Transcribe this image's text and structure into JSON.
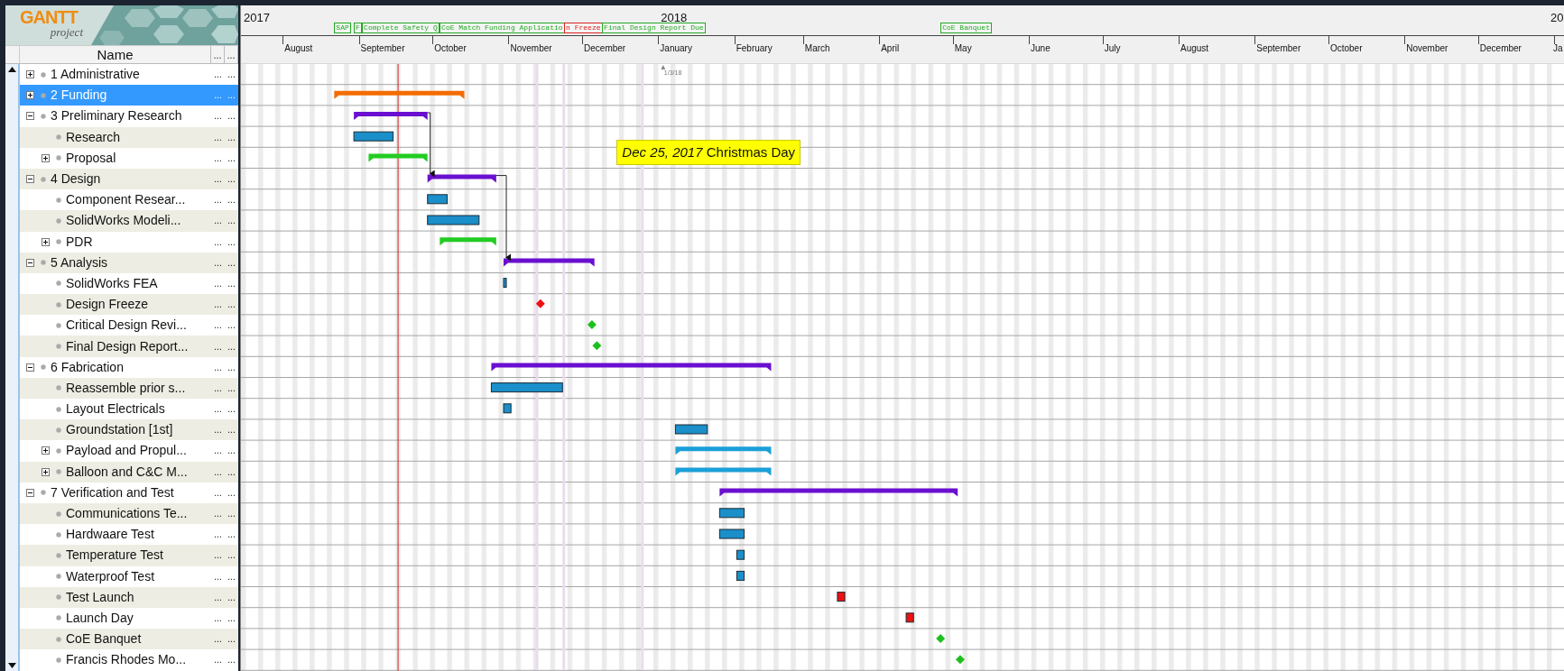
{
  "logo": {
    "title": "GANTT",
    "subtitle": "project"
  },
  "columns": [
    "Name",
    "...",
    "..."
  ],
  "tasks": [
    {
      "name": "1 Administrative",
      "expanded": false,
      "selected": false,
      "column_2": "...",
      "column_3": "..."
    },
    {
      "name": "2 Funding",
      "expanded": false,
      "selected": true,
      "column_2": "...",
      "column_3": "...",
      "bar": {
        "kind": "summary",
        "color": "#f36c00"
      }
    },
    {
      "name": "3 Preliminary Research",
      "expanded": true,
      "selected": false,
      "column_2": "...",
      "column_3": "...",
      "bar": {
        "kind": "summary",
        "color": "#6a0fd0"
      },
      "children": [
        {
          "name": "Research",
          "selected": false,
          "column_2": "...",
          "column_3": "...",
          "bar": {
            "kind": "task",
            "color": "#1a8fc9"
          }
        },
        {
          "name": "Proposal",
          "expanded": false,
          "selected": false,
          "column_2": "...",
          "column_3": "...",
          "bar": {
            "kind": "summary",
            "color": "#22cc22"
          }
        }
      ]
    },
    {
      "name": "4 Design",
      "expanded": true,
      "selected": false,
      "column_2": "...",
      "column_3": "...",
      "bar": {
        "kind": "summary",
        "color": "#6a0fd0"
      },
      "children": [
        {
          "name": "Component Resear...",
          "selected": false,
          "column_2": "...",
          "column_3": "...",
          "bar": {
            "kind": "task",
            "color": "#1a8fc9"
          }
        },
        {
          "name": "SolidWorks Modeli...",
          "selected": false,
          "column_2": "...",
          "column_3": "...",
          "bar": {
            "kind": "task",
            "color": "#1a8fc9"
          }
        },
        {
          "name": "PDR",
          "expanded": false,
          "selected": false,
          "column_2": "...",
          "column_3": "...",
          "bar": {
            "kind": "summary",
            "color": "#22cc22"
          }
        }
      ]
    },
    {
      "name": "5 Analysis",
      "expanded": true,
      "selected": false,
      "column_2": "...",
      "column_3": "...",
      "bar": {
        "kind": "summary",
        "color": "#6a0fd0"
      },
      "children": [
        {
          "name": "SolidWorks FEA",
          "selected": false,
          "column_2": "...",
          "column_3": "...",
          "bar": {
            "kind": "task",
            "color": "#1a8fc9"
          }
        },
        {
          "name": "Design Freeze",
          "selected": false,
          "column_2": "...",
          "column_3": "...",
          "bar": {
            "kind": "milestone",
            "color": "#ee1111"
          }
        },
        {
          "name": "Critical Design Revi...",
          "selected": false,
          "column_2": "...",
          "column_3": "...",
          "bar": {
            "kind": "milestone",
            "color": "#1ec01e"
          }
        },
        {
          "name": "Final Design Report...",
          "selected": false,
          "column_2": "...",
          "column_3": "...",
          "bar": {
            "kind": "milestone",
            "color": "#1ec01e"
          }
        }
      ]
    },
    {
      "name": "6 Fabrication",
      "expanded": true,
      "selected": false,
      "column_2": "...",
      "column_3": "...",
      "bar": {
        "kind": "summary",
        "color": "#6a0fd0"
      },
      "children": [
        {
          "name": "Reassemble prior s...",
          "selected": false,
          "column_2": "...",
          "column_3": "...",
          "bar": {
            "kind": "task",
            "color": "#1a8fc9"
          }
        },
        {
          "name": "Layout Electricals",
          "selected": false,
          "column_2": "...",
          "column_3": "...",
          "bar": {
            "kind": "task",
            "color": "#1a8fc9"
          }
        },
        {
          "name": "Groundstation  [1st]",
          "selected": false,
          "column_2": "...",
          "column_3": "...",
          "bar": {
            "kind": "task",
            "color": "#1a8fc9"
          }
        },
        {
          "name": "Payload and Propul...",
          "expanded": false,
          "selected": false,
          "column_2": "...",
          "column_3": "...",
          "bar": {
            "kind": "summary",
            "color": "#1aa0d8"
          }
        },
        {
          "name": "Balloon and C&C M...",
          "expanded": false,
          "selected": false,
          "column_2": "...",
          "column_3": "...",
          "bar": {
            "kind": "summary",
            "color": "#1aa0d8"
          }
        }
      ]
    },
    {
      "name": "7 Verification and Test",
      "expanded": true,
      "selected": false,
      "column_2": "...",
      "column_3": "...",
      "bar": {
        "kind": "summary",
        "color": "#6a0fd0"
      },
      "children": [
        {
          "name": "Communications Te...",
          "selected": false,
          "column_2": "...",
          "column_3": "...",
          "bar": {
            "kind": "task",
            "color": "#1a8fc9"
          }
        },
        {
          "name": "Hardwaare Test",
          "selected": false,
          "column_2": "...",
          "column_3": "...",
          "bar": {
            "kind": "task",
            "color": "#1a8fc9"
          }
        },
        {
          "name": "Temperature Test",
          "selected": false,
          "column_2": "...",
          "column_3": "...",
          "bar": {
            "kind": "task",
            "color": "#1a8fc9"
          }
        },
        {
          "name": "Waterproof Test",
          "selected": false,
          "column_2": "...",
          "column_3": "...",
          "bar": {
            "kind": "task",
            "color": "#1a8fc9"
          }
        },
        {
          "name": "Test Launch",
          "selected": false,
          "column_2": "...",
          "column_3": "...",
          "bar": {
            "kind": "task",
            "color": "#ee1111"
          }
        },
        {
          "name": "Launch Day",
          "selected": false,
          "column_2": "...",
          "column_3": "...",
          "bar": {
            "kind": "task",
            "color": "#ee1111"
          }
        },
        {
          "name": "CoE Banquet",
          "selected": false,
          "column_2": "...",
          "column_3": "...",
          "bar": {
            "kind": "milestone",
            "color": "#1ec01e"
          }
        },
        {
          "name": "Francis Rhodes Mo...",
          "selected": false,
          "column_2": "...",
          "column_3": "...",
          "bar": {
            "kind": "milestone",
            "color": "#1ec01e"
          }
        }
      ]
    }
  ],
  "timeline": {
    "years": [
      "2017",
      "2018",
      "20"
    ],
    "months": [
      "August",
      "September",
      "October",
      "November",
      "December",
      "January",
      "February",
      "March",
      "April",
      "May",
      "June",
      "July",
      "August",
      "September",
      "October",
      "November",
      "December",
      "Ja"
    ],
    "flags": [
      {
        "label": "SAP",
        "color": "#22aa22"
      },
      {
        "label": "F",
        "color": "#22aa22"
      },
      {
        "label": "Complete Safety Q",
        "color": "#22aa22"
      },
      {
        "label": "CoE Match Funding Applicatio",
        "color": "#22aa22"
      },
      {
        "label": "n Freeze",
        "color": "#dd2222"
      },
      {
        "label": "Final Design Report Due",
        "color": "#22aa22"
      },
      {
        "label": "CoE Banquet",
        "color": "#22aa22"
      }
    ],
    "marker": {
      "label": "1/3/18"
    },
    "tooltip": {
      "text": "*Dec 25, 2017* Christmas Day"
    }
  }
}
